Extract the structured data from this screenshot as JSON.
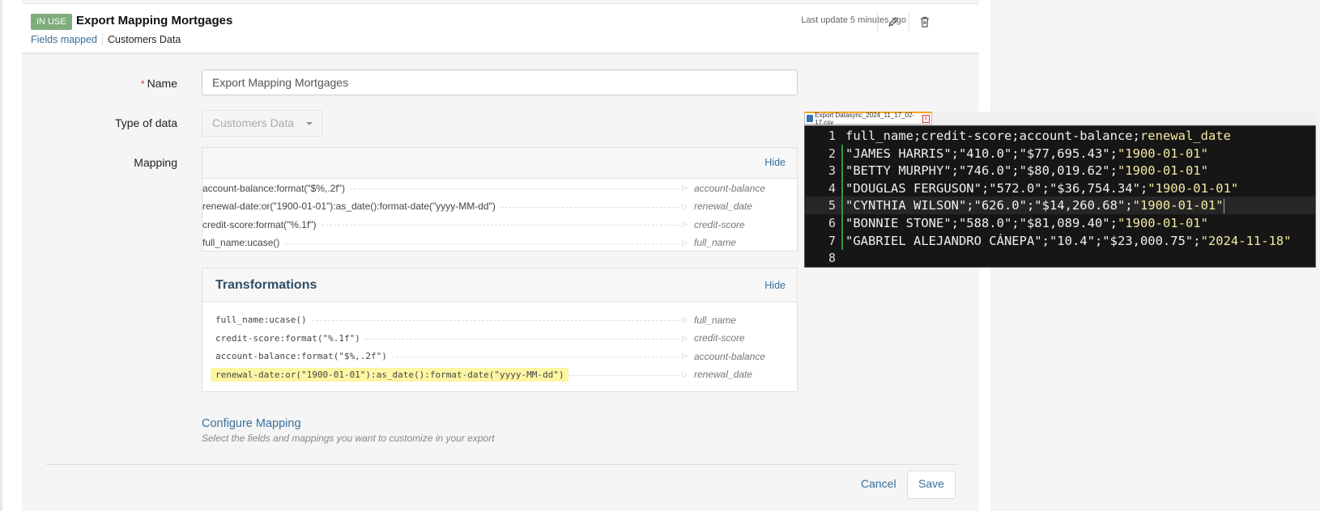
{
  "header": {
    "status_badge": "IN USE",
    "title": "Export Mapping Mortgages",
    "links": {
      "fields_mapped": "Fields mapped",
      "type": "Customers Data"
    },
    "last_update": "Last update 5 minutes ago",
    "icons": {
      "edit": "pencil-icon",
      "delete": "trash-icon"
    }
  },
  "form": {
    "name": {
      "label": "Name",
      "required_mark": "*",
      "value": "Export Mapping Mortgages"
    },
    "type_of_data": {
      "label": "Type of data",
      "value": "Customers Data"
    },
    "mapping": {
      "label": "Mapping",
      "hide_label": "Hide",
      "rows": [
        {
          "expr": "account-balance:format(\"$%,.2f\")",
          "target": "account-balance"
        },
        {
          "expr": "renewal-date:or(\"1900-01-01\"):as_date():format-date(\"yyyy-MM-dd\")",
          "target": "renewal_date"
        },
        {
          "expr": "credit-score:format(\"%.1f\")",
          "target": "credit-score"
        },
        {
          "expr": "full_name:ucase()",
          "target": "full_name"
        }
      ]
    },
    "transformations": {
      "title": "Transformations",
      "hide_label": "Hide",
      "rows": [
        {
          "expr": "full_name:ucase()",
          "target": "full_name",
          "highlighted": false
        },
        {
          "expr": "credit-score:format(\"%.1f\")",
          "target": "credit-score",
          "highlighted": false
        },
        {
          "expr": "account-balance:format(\"$%,.2f\")",
          "target": "account-balance",
          "highlighted": false
        },
        {
          "expr": "renewal-date:or(\"1900-01-01\"):as_date():format-date(\"yyyy-MM-dd\")",
          "target": "renewal_date",
          "highlighted": true
        }
      ]
    },
    "configure": {
      "link": "Configure Mapping",
      "description": "Select the fields and mappings you want to customize in your export"
    },
    "actions": {
      "cancel": "Cancel",
      "save": "Save"
    }
  },
  "editor": {
    "tab_title": "Export Datasync_2024_11_17_02-17.csv",
    "tab_close": "x",
    "current_line": 5,
    "lines": [
      {
        "num": "1",
        "main": "full_name;credit-score;account-balance;",
        "date": "renewal_date"
      },
      {
        "num": "2",
        "main": "\"JAMES HARRIS\";\"410.0\";\"$77,695.43\";",
        "date": "\"1900-01-01\""
      },
      {
        "num": "3",
        "main": "\"BETTY MURPHY\";\"746.0\";\"$80,019.62\";",
        "date": "\"1900-01-01\""
      },
      {
        "num": "4",
        "main": "\"DOUGLAS FERGUSON\";\"572.0\";\"$36,754.34\";",
        "date": "\"1900-01-01\""
      },
      {
        "num": "5",
        "main": "\"CYNTHIA WILSON\";\"626.0\";\"$14,260.68\";",
        "date": "\"1900-01-01\""
      },
      {
        "num": "6",
        "main": "\"BONNIE STONE\";\"588.0\";\"$81,089.40\";",
        "date": "\"1900-01-01\""
      },
      {
        "num": "7",
        "main": "\"GABRIEL ALEJANDRO CÁNEPA\";\"10.4\";\"$23,000.75\";",
        "date": "\"2024-11-18\""
      },
      {
        "num": "8",
        "main": "",
        "date": ""
      }
    ]
  },
  "colors": {
    "badge": "#7fac7c",
    "link": "#3a6f9a",
    "highlight": "#fdf6a3",
    "editor_bg": "#161616",
    "editor_string": "#f3e9a0"
  }
}
